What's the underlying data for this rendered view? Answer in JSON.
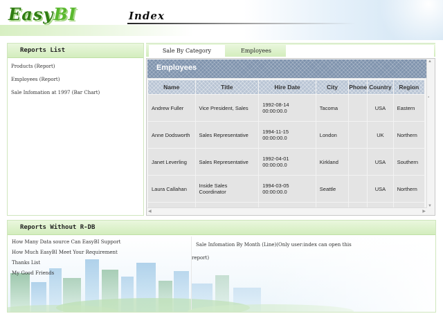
{
  "header": {
    "logo_prefix": "Easy",
    "logo_suffix": "BI",
    "page_title": "Index"
  },
  "reports_list": {
    "title": "Reports List",
    "items": [
      "Products (Report)",
      "Employees (Report)",
      "Sale Infomation at 1997 (Bar Chart)"
    ]
  },
  "tabs": [
    "Sale By Category",
    "Employees"
  ],
  "report": {
    "title": "Employees",
    "columns": [
      "Name",
      "Title",
      "Hire Date",
      "City",
      "Phone",
      "Country",
      "Region"
    ],
    "rows": [
      [
        "Andrew Fuller",
        "Vice President, Sales",
        "1992-08-14 00:00:00.0",
        "Tacoma",
        "",
        "USA",
        "Eastern"
      ],
      [
        "Anne Dodsworth",
        "Sales Representative",
        "1994-11-15 00:00:00.0",
        "London",
        "",
        "UK",
        "Northern"
      ],
      [
        "Janet Leverling",
        "Sales Representative",
        "1992-04-01 00:00:00.0",
        "Kirkland",
        "",
        "USA",
        "Southern"
      ],
      [
        "Laura Callahan",
        "Inside Sales Coordinator",
        "1994-03-05 00:00:00.0",
        "Seattle",
        "",
        "USA",
        "Northern"
      ]
    ]
  },
  "reports_without_db": {
    "title": "Reports Without R-DB",
    "items": [
      "How Many Data source Can EasyBI Support",
      "How Much EasyBI Meet Your Requirement",
      "Thanks List",
      "My Good Friends"
    ],
    "note_line1": "Sale Infomation By Month (Line)(Only user:index can open this",
    "note_line2": "report)"
  },
  "colors": {
    "brand_green": "#2f7d12",
    "panel_green": "#d3edbd",
    "report_header": "#7f93ad"
  }
}
